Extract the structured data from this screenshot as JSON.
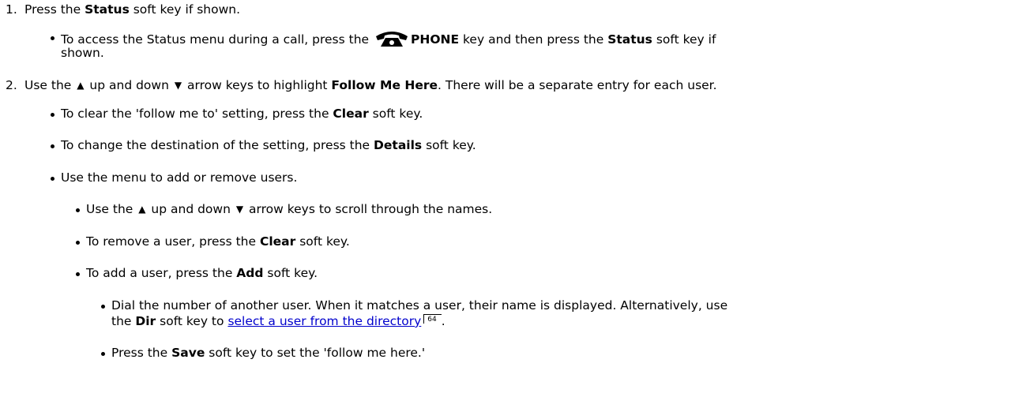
{
  "steps": [
    {
      "number": "1.",
      "text": {
        "a": "Press the ",
        "b1": "Status",
        "c": " soft key if shown."
      },
      "bullets": [
        {
          "a": "To access the Status menu during a call, press the ",
          "icon": "phone-icon",
          "key": "PHONE",
          "b": " key and then press the ",
          "bold": "Status",
          "c": " soft key if",
          "cont": "shown."
        }
      ]
    },
    {
      "number": "2.",
      "text": {
        "a": "Use the ",
        "up_icon": "up-arrow-icon",
        "b": " up and down ",
        "down_icon": "down-arrow-icon",
        "c": " arrow keys to highlight ",
        "bold": "Follow Me Here",
        "d": ". There will be a separate entry for each user."
      },
      "bullets": [
        {
          "a": "To clear the 'follow me to' setting, press the ",
          "bold": "Clear",
          "c": " soft key."
        },
        {
          "a": "To change the destination of the setting, press the ",
          "bold": "Details",
          "c": " soft key."
        },
        {
          "a": "Use the menu to add or remove users."
        }
      ],
      "sub_bullets": [
        {
          "a": "Use the ",
          "b": " up and down ",
          "c": " arrow keys to scroll through the names."
        },
        {
          "a": "To remove a user, press the ",
          "bold": "Clear",
          "c": " soft key."
        },
        {
          "a": "To add a user, press the ",
          "bold": "Add",
          "c": " soft key."
        }
      ],
      "sub_sub_bullets": [
        {
          "line1": "Dial the number of another user. When it matches a user, their name is displayed.  Alternatively, use",
          "line2_a": "the ",
          "bold": "Dir",
          "line2_b": " soft key to ",
          "link": "select a user from the directory",
          "page_ref": "64",
          "end": "."
        },
        {
          "a": "Press the ",
          "bold": "Save",
          "c": " soft key to set the 'follow me here.'"
        }
      ]
    }
  ],
  "colors": {
    "link": "#0000cc",
    "text": "#000000"
  }
}
